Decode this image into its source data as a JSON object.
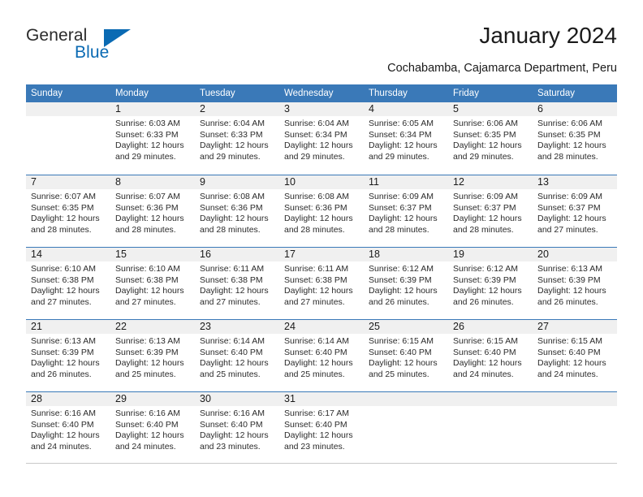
{
  "brand": {
    "name_part1": "General",
    "name_part2": "Blue"
  },
  "header": {
    "title": "January 2024",
    "subtitle": "Cochabamba, Cajamarca Department, Peru"
  },
  "colors": {
    "header_blue": "#3a79b8",
    "logo_blue": "#0a6ab3",
    "day_band": "#f0f0f0",
    "text": "#2b2b2b"
  },
  "weekdays": [
    "Sunday",
    "Monday",
    "Tuesday",
    "Wednesday",
    "Thursday",
    "Friday",
    "Saturday"
  ],
  "weeks": [
    [
      {
        "day": "",
        "sunrise": "",
        "sunset": "",
        "daylight": ""
      },
      {
        "day": "1",
        "sunrise": "Sunrise: 6:03 AM",
        "sunset": "Sunset: 6:33 PM",
        "daylight": "Daylight: 12 hours and 29 minutes."
      },
      {
        "day": "2",
        "sunrise": "Sunrise: 6:04 AM",
        "sunset": "Sunset: 6:33 PM",
        "daylight": "Daylight: 12 hours and 29 minutes."
      },
      {
        "day": "3",
        "sunrise": "Sunrise: 6:04 AM",
        "sunset": "Sunset: 6:34 PM",
        "daylight": "Daylight: 12 hours and 29 minutes."
      },
      {
        "day": "4",
        "sunrise": "Sunrise: 6:05 AM",
        "sunset": "Sunset: 6:34 PM",
        "daylight": "Daylight: 12 hours and 29 minutes."
      },
      {
        "day": "5",
        "sunrise": "Sunrise: 6:06 AM",
        "sunset": "Sunset: 6:35 PM",
        "daylight": "Daylight: 12 hours and 29 minutes."
      },
      {
        "day": "6",
        "sunrise": "Sunrise: 6:06 AM",
        "sunset": "Sunset: 6:35 PM",
        "daylight": "Daylight: 12 hours and 28 minutes."
      }
    ],
    [
      {
        "day": "7",
        "sunrise": "Sunrise: 6:07 AM",
        "sunset": "Sunset: 6:35 PM",
        "daylight": "Daylight: 12 hours and 28 minutes."
      },
      {
        "day": "8",
        "sunrise": "Sunrise: 6:07 AM",
        "sunset": "Sunset: 6:36 PM",
        "daylight": "Daylight: 12 hours and 28 minutes."
      },
      {
        "day": "9",
        "sunrise": "Sunrise: 6:08 AM",
        "sunset": "Sunset: 6:36 PM",
        "daylight": "Daylight: 12 hours and 28 minutes."
      },
      {
        "day": "10",
        "sunrise": "Sunrise: 6:08 AM",
        "sunset": "Sunset: 6:36 PM",
        "daylight": "Daylight: 12 hours and 28 minutes."
      },
      {
        "day": "11",
        "sunrise": "Sunrise: 6:09 AM",
        "sunset": "Sunset: 6:37 PM",
        "daylight": "Daylight: 12 hours and 28 minutes."
      },
      {
        "day": "12",
        "sunrise": "Sunrise: 6:09 AM",
        "sunset": "Sunset: 6:37 PM",
        "daylight": "Daylight: 12 hours and 28 minutes."
      },
      {
        "day": "13",
        "sunrise": "Sunrise: 6:09 AM",
        "sunset": "Sunset: 6:37 PM",
        "daylight": "Daylight: 12 hours and 27 minutes."
      }
    ],
    [
      {
        "day": "14",
        "sunrise": "Sunrise: 6:10 AM",
        "sunset": "Sunset: 6:38 PM",
        "daylight": "Daylight: 12 hours and 27 minutes."
      },
      {
        "day": "15",
        "sunrise": "Sunrise: 6:10 AM",
        "sunset": "Sunset: 6:38 PM",
        "daylight": "Daylight: 12 hours and 27 minutes."
      },
      {
        "day": "16",
        "sunrise": "Sunrise: 6:11 AM",
        "sunset": "Sunset: 6:38 PM",
        "daylight": "Daylight: 12 hours and 27 minutes."
      },
      {
        "day": "17",
        "sunrise": "Sunrise: 6:11 AM",
        "sunset": "Sunset: 6:38 PM",
        "daylight": "Daylight: 12 hours and 27 minutes."
      },
      {
        "day": "18",
        "sunrise": "Sunrise: 6:12 AM",
        "sunset": "Sunset: 6:39 PM",
        "daylight": "Daylight: 12 hours and 26 minutes."
      },
      {
        "day": "19",
        "sunrise": "Sunrise: 6:12 AM",
        "sunset": "Sunset: 6:39 PM",
        "daylight": "Daylight: 12 hours and 26 minutes."
      },
      {
        "day": "20",
        "sunrise": "Sunrise: 6:13 AM",
        "sunset": "Sunset: 6:39 PM",
        "daylight": "Daylight: 12 hours and 26 minutes."
      }
    ],
    [
      {
        "day": "21",
        "sunrise": "Sunrise: 6:13 AM",
        "sunset": "Sunset: 6:39 PM",
        "daylight": "Daylight: 12 hours and 26 minutes."
      },
      {
        "day": "22",
        "sunrise": "Sunrise: 6:13 AM",
        "sunset": "Sunset: 6:39 PM",
        "daylight": "Daylight: 12 hours and 25 minutes."
      },
      {
        "day": "23",
        "sunrise": "Sunrise: 6:14 AM",
        "sunset": "Sunset: 6:40 PM",
        "daylight": "Daylight: 12 hours and 25 minutes."
      },
      {
        "day": "24",
        "sunrise": "Sunrise: 6:14 AM",
        "sunset": "Sunset: 6:40 PM",
        "daylight": "Daylight: 12 hours and 25 minutes."
      },
      {
        "day": "25",
        "sunrise": "Sunrise: 6:15 AM",
        "sunset": "Sunset: 6:40 PM",
        "daylight": "Daylight: 12 hours and 25 minutes."
      },
      {
        "day": "26",
        "sunrise": "Sunrise: 6:15 AM",
        "sunset": "Sunset: 6:40 PM",
        "daylight": "Daylight: 12 hours and 24 minutes."
      },
      {
        "day": "27",
        "sunrise": "Sunrise: 6:15 AM",
        "sunset": "Sunset: 6:40 PM",
        "daylight": "Daylight: 12 hours and 24 minutes."
      }
    ],
    [
      {
        "day": "28",
        "sunrise": "Sunrise: 6:16 AM",
        "sunset": "Sunset: 6:40 PM",
        "daylight": "Daylight: 12 hours and 24 minutes."
      },
      {
        "day": "29",
        "sunrise": "Sunrise: 6:16 AM",
        "sunset": "Sunset: 6:40 PM",
        "daylight": "Daylight: 12 hours and 24 minutes."
      },
      {
        "day": "30",
        "sunrise": "Sunrise: 6:16 AM",
        "sunset": "Sunset: 6:40 PM",
        "daylight": "Daylight: 12 hours and 23 minutes."
      },
      {
        "day": "31",
        "sunrise": "Sunrise: 6:17 AM",
        "sunset": "Sunset: 6:40 PM",
        "daylight": "Daylight: 12 hours and 23 minutes."
      },
      {
        "day": "",
        "sunrise": "",
        "sunset": "",
        "daylight": ""
      },
      {
        "day": "",
        "sunrise": "",
        "sunset": "",
        "daylight": ""
      },
      {
        "day": "",
        "sunrise": "",
        "sunset": "",
        "daylight": ""
      }
    ]
  ]
}
